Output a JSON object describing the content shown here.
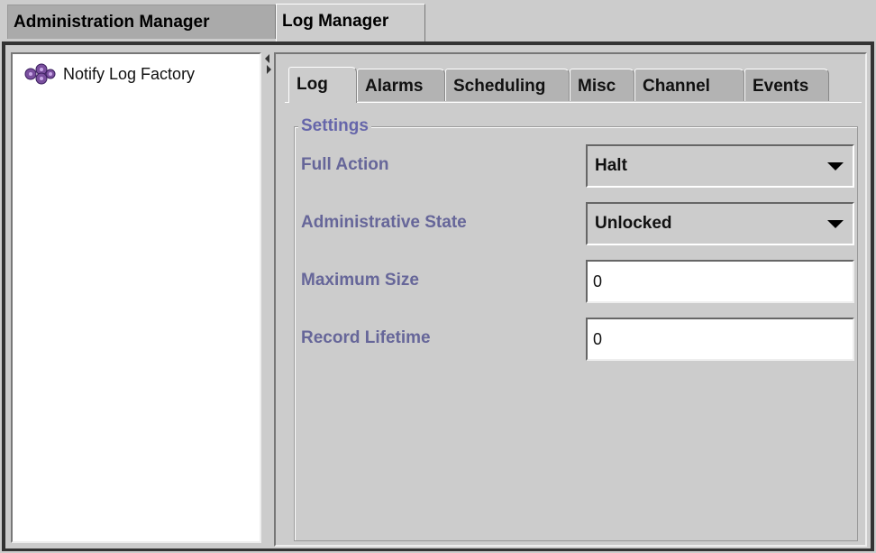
{
  "top_tabs": [
    {
      "label": "Administration Manager",
      "active": false
    },
    {
      "label": "Log Manager",
      "active": true
    }
  ],
  "tree": {
    "items": [
      {
        "label": "Notify Log Factory",
        "icon": "cog-icon"
      }
    ]
  },
  "inner_tabs": [
    {
      "label": "Log",
      "active": true
    },
    {
      "label": "Alarms",
      "active": false
    },
    {
      "label": "Scheduling",
      "active": false
    },
    {
      "label": "Misc",
      "active": false
    },
    {
      "label": "Channel",
      "active": false
    },
    {
      "label": "Events",
      "active": false
    }
  ],
  "settings": {
    "legend": "Settings",
    "full_action": {
      "label": "Full Action",
      "value": "Halt"
    },
    "admin_state": {
      "label": "Administrative State",
      "value": "Unlocked"
    },
    "max_size": {
      "label": "Maximum Size",
      "value": "0"
    },
    "record_lifetime": {
      "label": "Record Lifetime",
      "value": "0"
    }
  },
  "colors": {
    "background": "#cccccc",
    "label": "#666699",
    "inactive_tab": "#aaaaaa"
  }
}
